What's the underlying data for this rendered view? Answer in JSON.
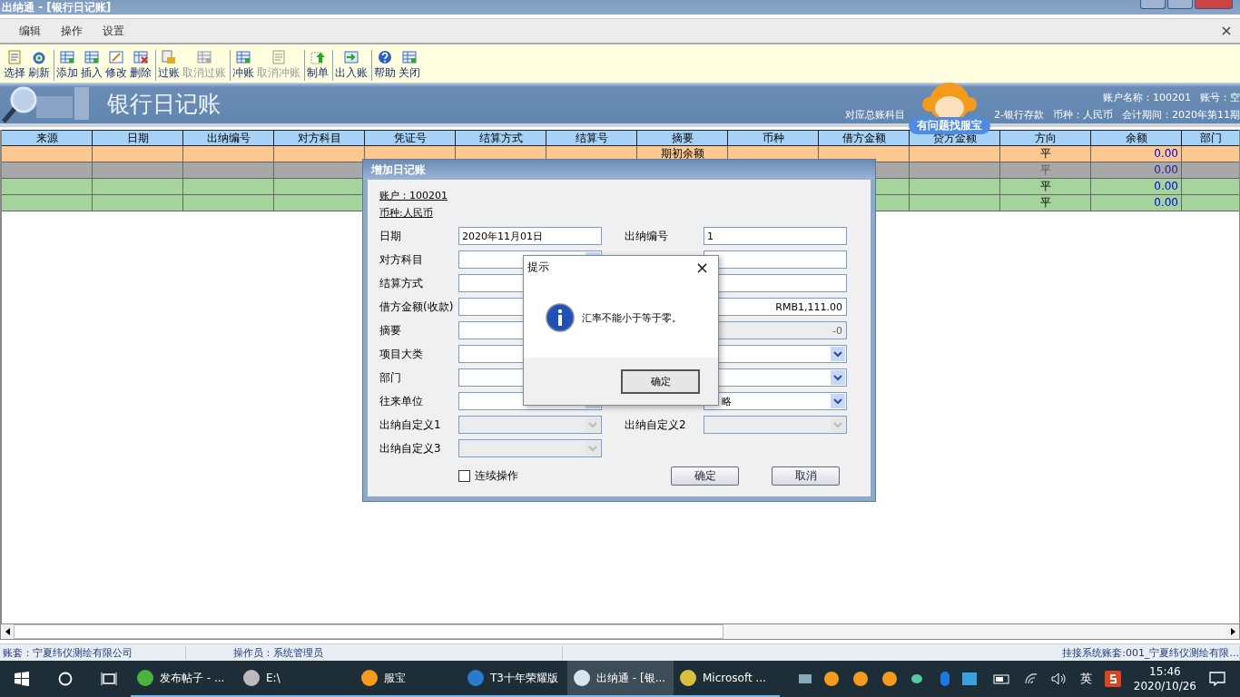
{
  "window": {
    "title": "出纳通 - [银行日记账]"
  },
  "menu": [
    "编辑",
    "操作",
    "设置"
  ],
  "toolbar": [
    [
      {
        "label": "选择",
        "disabled": false
      },
      {
        "label": "刷新",
        "disabled": false
      }
    ],
    [
      {
        "label": "添加",
        "disabled": false
      },
      {
        "label": "插入",
        "disabled": false
      },
      {
        "label": "修改",
        "disabled": false
      },
      {
        "label": "删除",
        "disabled": false
      }
    ],
    [
      {
        "label": "过账",
        "disabled": false
      },
      {
        "label": "取消过账",
        "disabled": true
      }
    ],
    [
      {
        "label": "冲账",
        "disabled": false
      },
      {
        "label": "取消冲账",
        "disabled": true
      }
    ],
    [
      {
        "label": "制单",
        "disabled": false
      }
    ],
    [
      {
        "label": "出入账",
        "disabled": false
      }
    ],
    [
      {
        "label": "帮助",
        "disabled": false
      },
      {
        "label": "关闭",
        "disabled": false
      }
    ]
  ],
  "banner": {
    "title": "银行日记账",
    "account_name": "账户名称：100201",
    "account_no": "账号：空",
    "subject": "对应总账科目",
    "subject_tail": "2-银行存款",
    "currency": "币种：人民币",
    "period": "会计期间：2020年第11期"
  },
  "helper": {
    "label": "有问题找服宝"
  },
  "table": {
    "columns": [
      "来源",
      "日期",
      "出纳编号",
      "对方科目",
      "凭证号",
      "结算方式",
      "结算号",
      "摘要",
      "币种",
      "借方金额",
      "贷方金额",
      "方向",
      "余额",
      "部门"
    ],
    "rows": [
      {
        "color": "#fcc890",
        "selected": false,
        "summary": "期初余额",
        "direction": "平",
        "balance": "0.00"
      },
      {
        "color": "#a8a8a8",
        "selected": true,
        "direction": "平",
        "balance": "0.00"
      },
      {
        "color": "#a4d49c",
        "selected": false,
        "direction": "平",
        "balance": "0.00"
      },
      {
        "color": "#a4d49c",
        "selected": false,
        "direction": "平",
        "balance": "0.00"
      }
    ]
  },
  "dialog": {
    "title": "增加日记账",
    "account": "账户：100201",
    "currency": "币种:人民币",
    "left": [
      {
        "label": "日期",
        "kind": "text",
        "value": "2020年11月01日",
        "disabled": false
      },
      {
        "label": "对方科目",
        "kind": "lookup",
        "disabled": false
      },
      {
        "label": "结算方式",
        "kind": "text",
        "disabled": false
      },
      {
        "label": "借方金额(收款)",
        "kind": "text",
        "disabled": false
      },
      {
        "label": "摘要",
        "kind": "text",
        "disabled": false
      },
      {
        "label": "项目大类",
        "kind": "select",
        "disabled": false
      },
      {
        "label": "部门",
        "kind": "text",
        "disabled": false
      },
      {
        "label": "往来单位",
        "kind": "lookup",
        "disabled": false
      },
      {
        "label": "出纳自定义1",
        "kind": "select",
        "disabled": true
      },
      {
        "label": "出纳自定义3",
        "kind": "select",
        "disabled": true
      }
    ],
    "right": [
      {
        "label": "出纳编号",
        "kind": "text",
        "value": "1",
        "disabled": false
      },
      {
        "kind": "text",
        "disabled": false
      },
      {
        "kind": "text",
        "disabled": false
      },
      {
        "kind": "text",
        "value": "RMB1,111.00",
        "disabled": false
      },
      {
        "kind": "text",
        "value": "-0",
        "disabled": true
      },
      {
        "kind": "select",
        "disabled": false
      },
      {
        "kind": "select",
        "disabled": false
      },
      {
        "kind": "select",
        "value": "略",
        "disabled": false
      },
      {
        "label": "出纳自定义2",
        "kind": "select",
        "disabled": true
      }
    ],
    "continuous": {
      "label": "连续操作",
      "checked": false
    },
    "buttons": [
      "确定",
      "取消"
    ]
  },
  "message": {
    "title": "提示",
    "close": "×",
    "text": "汇率不能小于等于零。",
    "button": "确定"
  },
  "status_bar": [
    "账套：宁夏纬仪测绘有限公司",
    "操作员：系统管理员",
    "挂接系统账套:001_宁夏纬仪测绘有限..."
  ],
  "taskbar": {
    "apps": [
      {
        "label": "发布帖子 - ...",
        "selected": false
      },
      {
        "label": "E:\\",
        "selected": false
      },
      {
        "label": "服宝",
        "selected": false
      },
      {
        "label": "T3十年荣耀版",
        "selected": false
      },
      {
        "label": "出纳通 - [银...",
        "selected": true
      },
      {
        "label": "Microsoft ...",
        "selected": false
      }
    ],
    "ime": "英",
    "time": "15:46",
    "date": "2020/10/26"
  }
}
